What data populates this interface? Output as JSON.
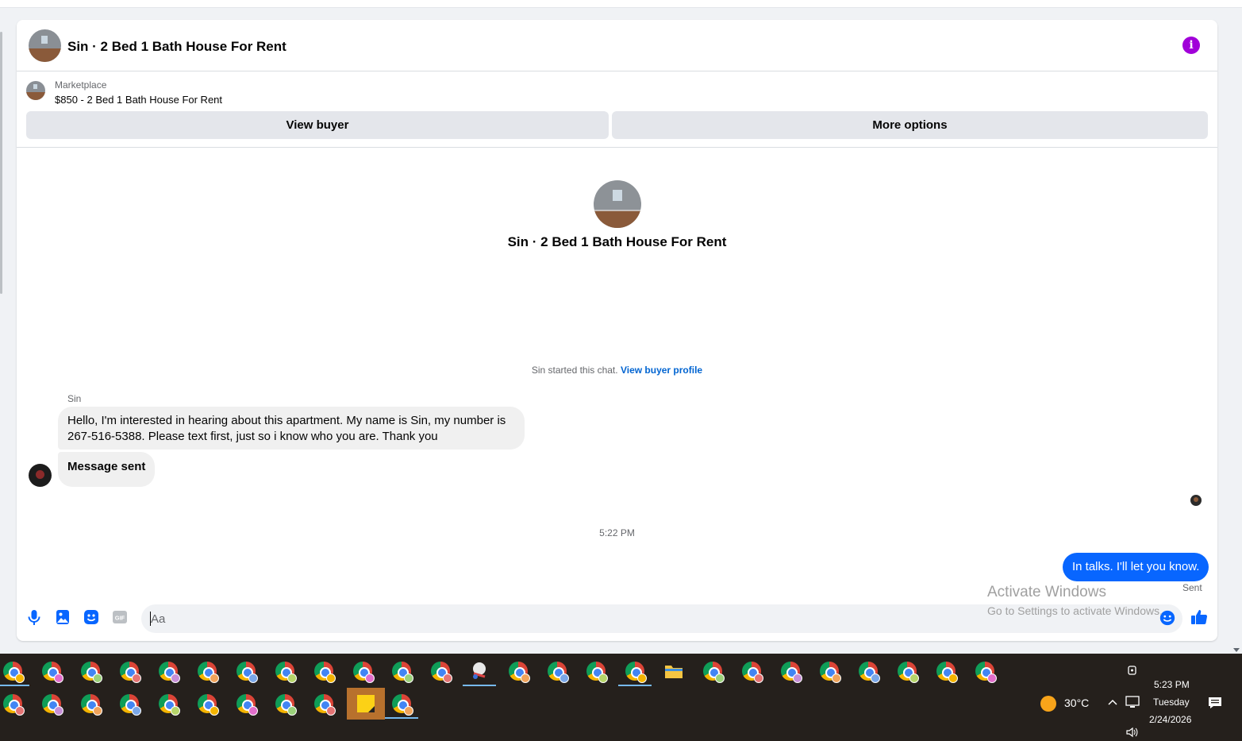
{
  "header": {
    "title": "Sin · 2 Bed 1 Bath House For Rent",
    "info_icon": "info-icon"
  },
  "marketplace": {
    "label": "Marketplace",
    "listing": "$850 - 2 Bed 1 Bath House For Rent",
    "view_buyer": "View buyer",
    "more_options": "More options"
  },
  "hero": {
    "title": "Sin · 2 Bed 1 Bath House For Rent"
  },
  "chat": {
    "started_text": "Sin started this chat.",
    "view_profile": "View buyer profile",
    "sender_name": "Sin",
    "message_1": "Hello, I'm interested in hearing about this apartment. My name is Sin, my number is 267-516-5388. Please text first, just so i know who you are. Thank you",
    "message_2": "Message sent",
    "timestamp": "5:22 PM",
    "my_message": "In talks. I'll let you know.",
    "status": "Sent"
  },
  "composer": {
    "placeholder": "Aa",
    "tools": [
      "microphone-icon",
      "photo-icon",
      "sticker-icon",
      "gif-icon",
      "emoji-icon",
      "thumbs-up-icon"
    ]
  },
  "watermark": {
    "line1": "Activate Windows",
    "line2": "Go to Settings to activate Windows."
  },
  "taskbar": {
    "weather_temp": "30°C",
    "time": "5:23 PM",
    "day": "Tuesday",
    "date": "2/24/2026"
  },
  "colors": {
    "accent": "#0866ff",
    "info": "#a100d9",
    "link": "#0064d1"
  }
}
